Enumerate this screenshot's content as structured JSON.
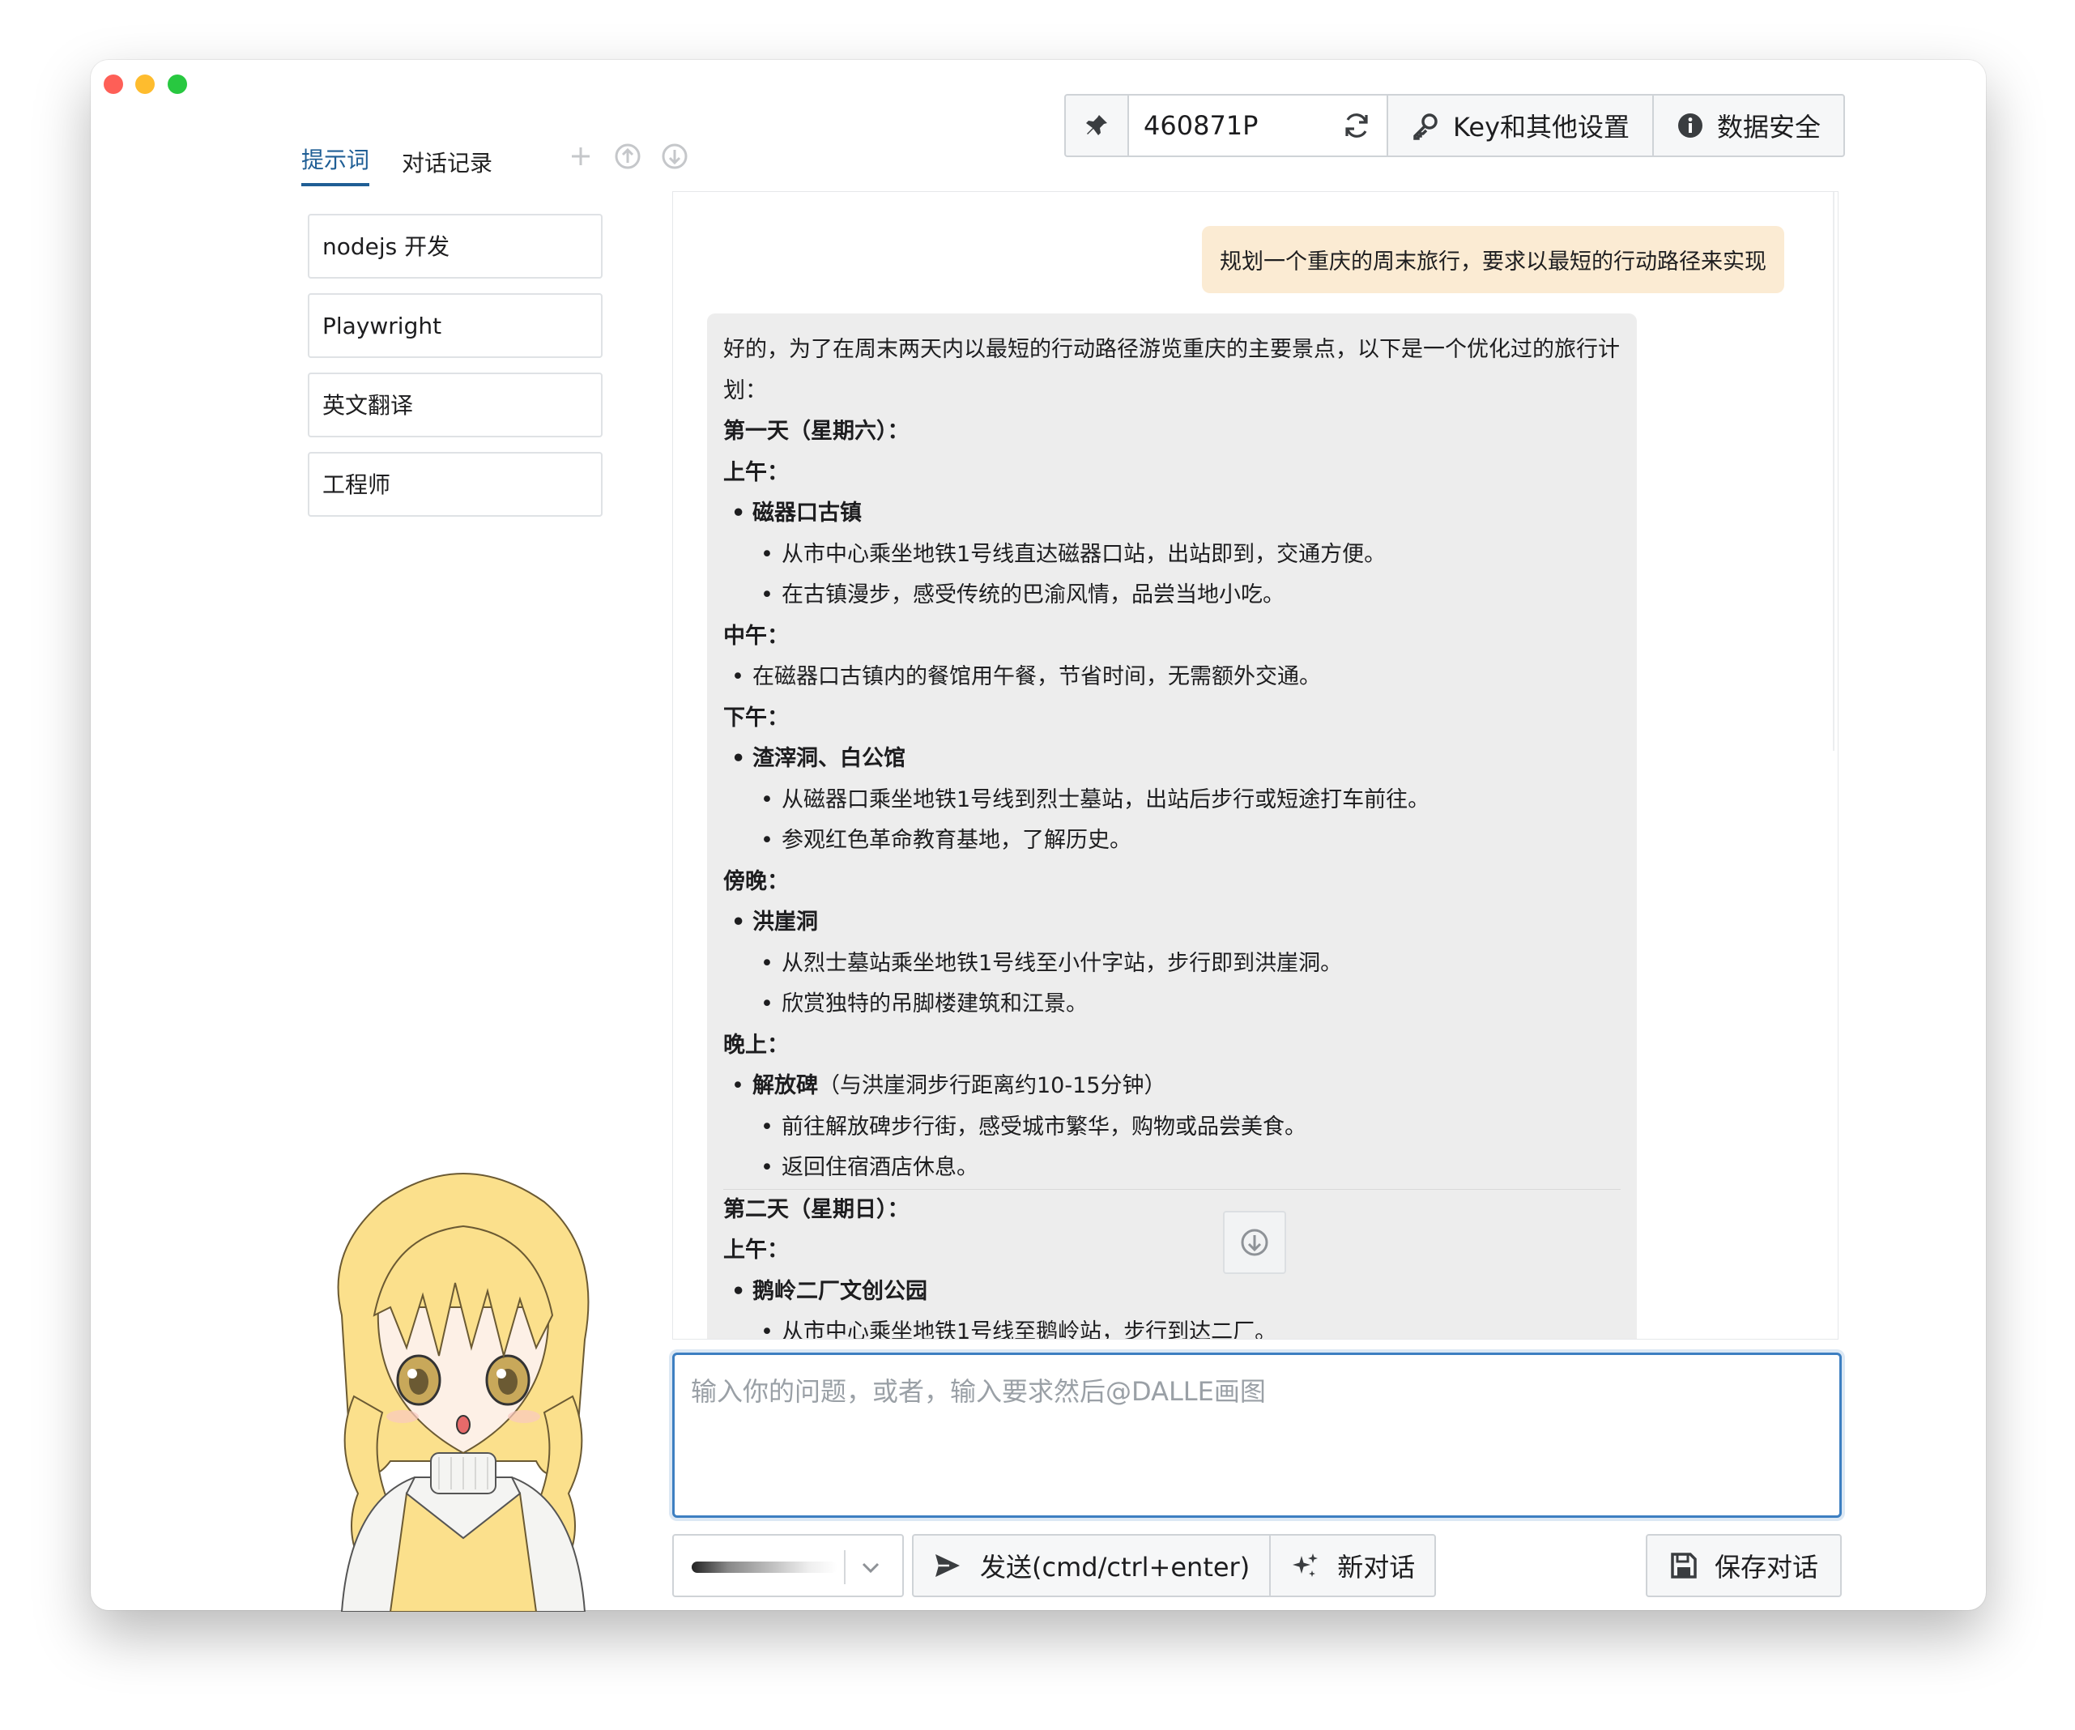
{
  "window": {
    "controls": [
      "close",
      "minimize",
      "maximize"
    ]
  },
  "tabs": [
    {
      "label": "提示词",
      "active": true
    },
    {
      "label": "对话记录",
      "active": false
    }
  ],
  "tab_actions": [
    {
      "icon": "plus-icon"
    },
    {
      "icon": "arrow-up-circle-icon"
    },
    {
      "icon": "arrow-down-circle-icon"
    }
  ],
  "prompts": [
    {
      "label": "nodejs 开发"
    },
    {
      "label": "Playwright"
    },
    {
      "label": "英文翻译"
    },
    {
      "label": "工程师"
    }
  ],
  "toolbar": {
    "pin_icon": "pin-icon",
    "key_value": "460871P",
    "refresh_icon": "refresh-icon",
    "settings_label": "Key和其他设置",
    "settings_icon": "key-icon",
    "security_label": "数据安全",
    "security_icon": "info-icon"
  },
  "chat": {
    "user_message": "规划一个重庆的周末旅行，要求以最短的行动路径来实现",
    "assistant": {
      "intro": "好的，为了在周末两天内以最短的行动路径游览重庆的主要景点，以下是一个优化过的旅行计划：",
      "day1_title": "第一天（星期六）：",
      "morning": "上午：",
      "spot1": "磁器口古镇",
      "spot1_a": "从市中心乘坐地铁1号线直达磁器口站，出站即到，交通方便。",
      "spot1_b": "在古镇漫步，感受传统的巴渝风情，品尝当地小吃。",
      "noon": "中午：",
      "noon_a": "在磁器口古镇内的餐馆用午餐，节省时间，无需额外交通。",
      "afternoon": "下午：",
      "spot2": "渣滓洞、白公馆",
      "spot2_a": "从磁器口乘坐地铁1号线到烈士墓站，出站后步行或短途打车前往。",
      "spot2_b": "参观红色革命教育基地，了解历史。",
      "dusk": "傍晚：",
      "spot3": "洪崖洞",
      "spot3_a": "从烈士墓站乘坐地铁1号线至小什字站，步行即到洪崖洞。",
      "spot3_b": "欣赏独特的吊脚楼建筑和江景。",
      "evening": "晚上：",
      "spot4": "解放碑",
      "spot4_note": "（与洪崖洞步行距离约10-15分钟）",
      "spot4_a": "前往解放碑步行街，感受城市繁华，购物或品尝美食。",
      "spot4_b": "返回住宿酒店休息。",
      "day2_title": "第二天（星期日）：",
      "day2_morning": "上午：",
      "spot5": "鹅岭二厂文创公园",
      "spot5_a": "从市中心乘坐地铁1号线至鹅岭站，步行到达二厂。"
    },
    "scroll_down_icon": "arrow-down-circle-icon"
  },
  "input": {
    "placeholder": "输入你的问题，或者，输入要求然后@DALLE画图",
    "value": ""
  },
  "bottom": {
    "model_icon": "chevron-down-icon",
    "send_label": "发送(cmd/ctrl+enter)",
    "send_icon": "send-icon",
    "new_label": "新对话",
    "new_icon": "sparkle-icon",
    "save_label": "保存对话",
    "save_icon": "save-icon"
  },
  "colors": {
    "accent": "#1f5e95",
    "input_focus": "#3d7fc1",
    "user_bubble": "#fbebd3",
    "assistant_bubble": "#ededed"
  }
}
